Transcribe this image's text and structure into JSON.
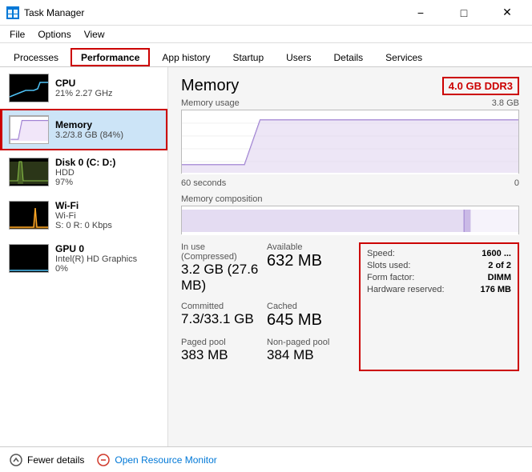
{
  "titlebar": {
    "title": "Task Manager",
    "min": "−",
    "max": "□",
    "close": "✕"
  },
  "menubar": {
    "items": [
      "File",
      "Options",
      "View"
    ]
  },
  "tabs": {
    "items": [
      "Processes",
      "Performance",
      "App history",
      "Startup",
      "Users",
      "Details",
      "Services"
    ],
    "active": 1
  },
  "sidebar": {
    "items": [
      {
        "id": "cpu",
        "name": "CPU",
        "sub1": "21% 2.27 GHz",
        "sub2": "",
        "color": "#4fc3f7"
      },
      {
        "id": "memory",
        "name": "Memory",
        "sub1": "3.2/3.8 GB (84%)",
        "sub2": "",
        "color": "#9c7fbf",
        "active": true
      },
      {
        "id": "disk",
        "name": "Disk 0 (C: D:)",
        "sub1": "HDD",
        "sub2": "97%",
        "color": "#8bc34a"
      },
      {
        "id": "wifi",
        "name": "Wi-Fi",
        "sub1": "Wi-Fi",
        "sub2": "S: 0 R: 0 Kbps",
        "color": "#ffa726"
      },
      {
        "id": "gpu",
        "name": "GPU 0",
        "sub1": "Intel(R) HD Graphics",
        "sub2": "0%",
        "color": "#4fc3f7"
      }
    ]
  },
  "content": {
    "title": "Memory",
    "badge": "4.0 GB DDR3",
    "usage_label": "Memory usage",
    "usage_max": "3.8 GB",
    "time_left": "60 seconds",
    "time_right": "0",
    "composition_label": "Memory composition",
    "stats": {
      "in_use_label": "In use (Compressed)",
      "in_use_value": "3.2 GB (27.6 MB)",
      "available_label": "Available",
      "available_value": "632 MB",
      "committed_label": "Committed",
      "committed_value": "7.3/33.1 GB",
      "cached_label": "Cached",
      "cached_value": "645 MB",
      "paged_label": "Paged pool",
      "paged_value": "383 MB",
      "nonpaged_label": "Non-paged pool",
      "nonpaged_value": "384 MB"
    },
    "info": {
      "speed_label": "Speed:",
      "speed_value": "1600 ...",
      "slots_label": "Slots used:",
      "slots_value": "2 of 2",
      "form_label": "Form factor:",
      "form_value": "DIMM",
      "hw_label": "Hardware reserved:",
      "hw_value": "176 MB"
    }
  },
  "footer": {
    "fewer_label": "Fewer details",
    "monitor_label": "Open Resource Monitor"
  }
}
